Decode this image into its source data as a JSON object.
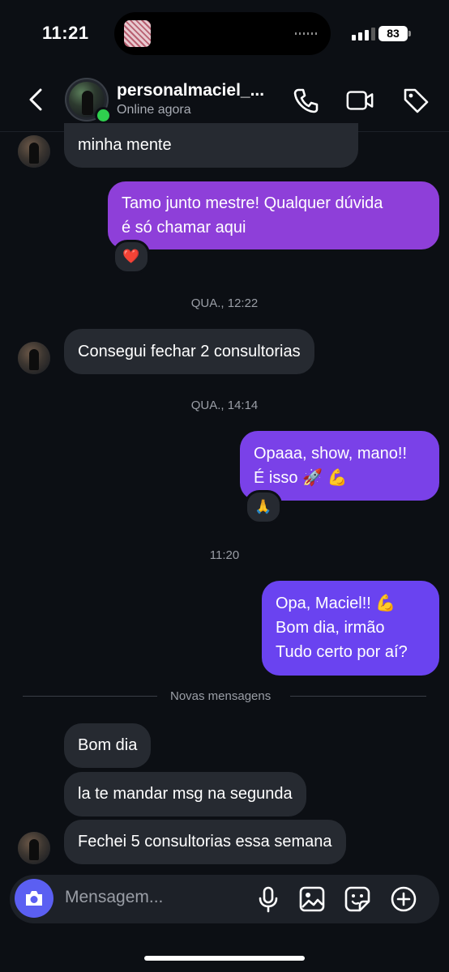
{
  "status_bar": {
    "time": "11:21",
    "battery": "83"
  },
  "header": {
    "username": "personalmaciel_...",
    "status": "Online agora",
    "icons": [
      "back-icon",
      "phone-icon",
      "video-icon",
      "tag-icon"
    ]
  },
  "messages": {
    "m1": "minha mente",
    "m2_line1": "Tamo junto mestre! Qualquer dúvida",
    "m2_line2": "é só chamar aqui",
    "m2_reaction": "❤️",
    "ts1": "QUA., 12:22",
    "m3": "Consegui fechar 2 consultorias",
    "ts2": "QUA., 14:14",
    "m4_line1": "Opaaa, show, mano!!",
    "m4_line2": "É isso 🚀 💪",
    "m4_reaction": "🙏",
    "ts3": "11:20",
    "m5_line1": "Opa, Maciel!! 💪",
    "m5_line2": "Bom dia, irmão",
    "m5_line3": "Tudo certo por aí?",
    "separator": "Novas mensagens",
    "m6": "Bom dia",
    "m7": "la te mandar msg na segunda",
    "m8": "Fechei 5 consultorias essa semana"
  },
  "composer": {
    "placeholder": "Mensagem...",
    "icons": [
      "camera-icon",
      "microphone-icon",
      "gallery-icon",
      "sticker-icon",
      "plus-icon"
    ]
  },
  "colors": {
    "background": "#0c0f14",
    "incoming": "#262a31",
    "outgoing_top": "#8e3fd9",
    "outgoing_bottom": "#6a43f0",
    "online": "#2fcf4e",
    "camera": "#5b5ff2"
  }
}
